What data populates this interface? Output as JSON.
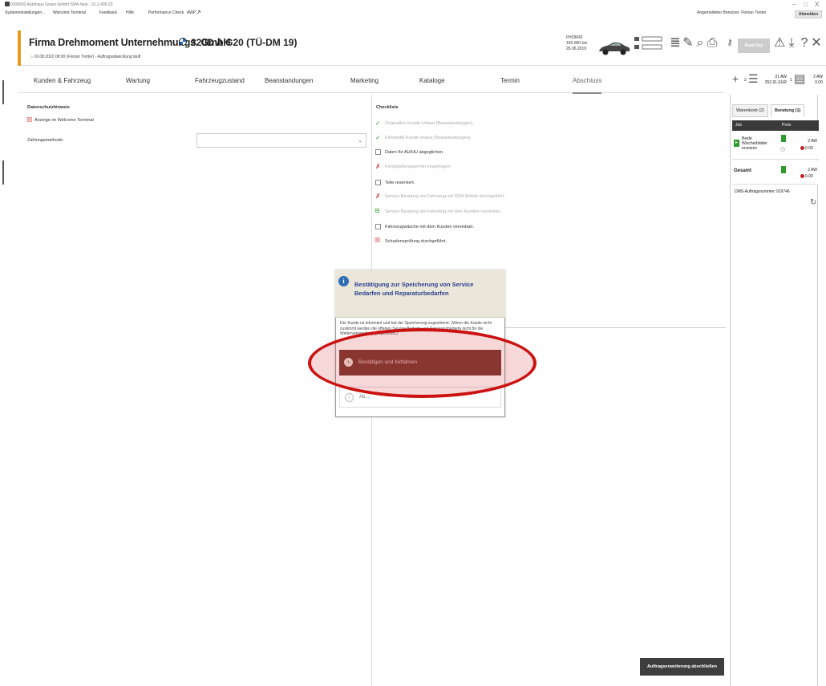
{
  "window": {
    "title": "0100603 Autohaus Gruen GmbH ISPA Next - 21.2.400.23",
    "min": "–",
    "max": "□",
    "close": "X"
  },
  "menubar": {
    "items": [
      "Systemeinstellungen...",
      "Welcome Terminal",
      "Feedback",
      "Hilfe",
      "Performance Check",
      "AWP"
    ],
    "user_label": "Angemeldeter Benutzer: Florian Tretter",
    "logout": "Abmelden"
  },
  "header": {
    "customer": "Firma Drehmoment Unternehmungs. GmbH",
    "vehicle": "320D A  G20  (TÜ-DM 19)",
    "subline": "16.08.2022 08:00 (Florian Tretter)  -  Auftragsabwicklung läuft",
    "vin": "FH29642",
    "mileage": "150.000 km",
    "date": "26.06.2019",
    "read_key": "Read Key"
  },
  "tabs": [
    {
      "label": "Kunden & Fahrzeug"
    },
    {
      "label": "Wartung"
    },
    {
      "label": "Fahrzeugzustand"
    },
    {
      "label": "Beanstandungen"
    },
    {
      "label": "Marketing"
    },
    {
      "label": "Kataloge"
    },
    {
      "label": "Termin"
    },
    {
      "label": "Abschluss"
    }
  ],
  "summary": {
    "plus": "+",
    "cart_count": "2",
    "aw": "21 AW",
    "eur": "252.91 EUR",
    "list_count": "1",
    "aw2": "2 AW",
    "eur2": "0.00"
  },
  "left": {
    "section_title": "Datenschutzhinweis",
    "welcome_item": "Anzeige im Welcome Terminal",
    "payment_label": "Zahlungsmethode:"
  },
  "checklist": {
    "title": "Checkliste",
    "items": [
      {
        "mark": "✓",
        "state": "done",
        "text": "Originalton Kunde erfasst (Beanstandungen)."
      },
      {
        "mark": "✓",
        "state": "done",
        "text": "Fehlerbild Kunde erfasst (Beanstandungen)."
      },
      {
        "mark": "",
        "state": "open",
        "text": "Daten für AU/HU abgeglichen."
      },
      {
        "mark": "✗",
        "state": "failed",
        "text": "Fertigstellungstermin eingetragen."
      },
      {
        "mark": "",
        "state": "open",
        "text": "Teile reserviert."
      },
      {
        "mark": "✗",
        "state": "failed",
        "text": "Service Beratung am Fahrzeug mit ISPA Mobile durchgeführt."
      },
      {
        "mark": "⊟",
        "state": "partial",
        "text": "Service Beratung am Fahrzeug mit dem Kunden vereinbart."
      },
      {
        "mark": "",
        "state": "open",
        "text": "Fahrzeugwäsche mit dem Kunden vereinbart."
      },
      {
        "mark": "✗",
        "state": "failed_box",
        "text": "Schadensprüfung durchgeführt."
      }
    ]
  },
  "sidebar": {
    "tab_cart": "Warenkorb (2)",
    "tab_advice": "Beratung (1)",
    "col_job": "Job",
    "col_price": "Preis",
    "job_name": "Beide Wischerblätter ersetzen",
    "job_aw": "2 AW",
    "job_price": "0.00",
    "total_label": "Gesamt",
    "total_aw": "2 AW",
    "total_price": "0.00",
    "dms_label": "DMS-Auftragsnummer:",
    "dms_number": "919746",
    "refresh_glyph": "↻"
  },
  "dialog": {
    "title": "Bestätigung zur Speicherung von Service Bedarfen und Reparaturbedarfen",
    "body": "Der Kunde ist informiert und hat der Speicherung zugestimmt. (Wenn die Kunde nicht zustimmt werden die offenen Service Bedarfe und Reparaturbedarfe nicht für die Weiterverwendung gespeichert.)",
    "confirm": "Bestätigen und fortfahren",
    "cancel": "Ab..."
  },
  "footer": {
    "finish": "Auftragserweiterung abschließen"
  },
  "colors": {
    "accent": "#e89c1a",
    "confirm_button": "#7b3a34",
    "highlight": "#cc1111",
    "dialog_title": "#2a3f8f"
  }
}
